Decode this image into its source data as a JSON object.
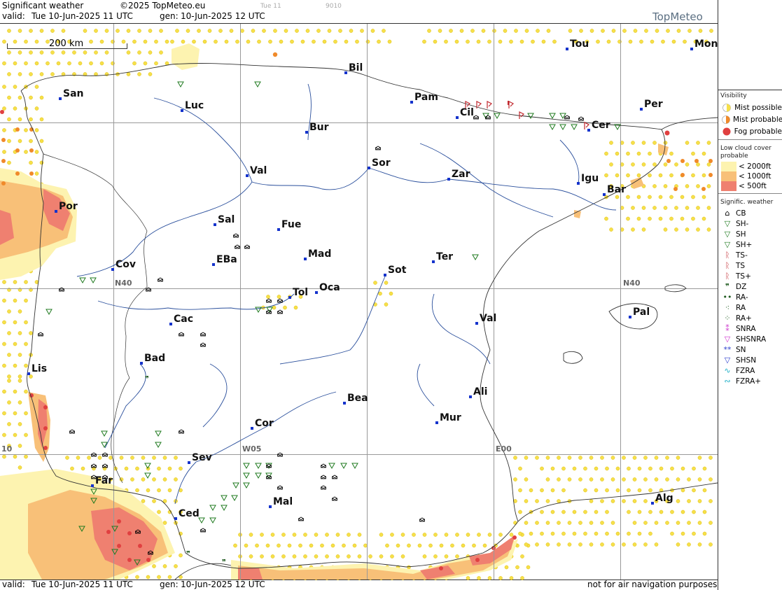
{
  "header": {
    "title": "Significant weather",
    "copyright": "©2025 TopMeteo.eu",
    "run_label": "Tue 11",
    "code": "9010",
    "valid_label": "valid:",
    "valid_value": "Tue  10-Jun-2025  11 UTC",
    "gen_label": "gen:",
    "gen_value": "10-Jun-2025 12 UTC",
    "brand": "TopMeteo"
  },
  "footer": {
    "valid_label": "valid:",
    "valid_value": "Tue  10-Jun-2025  11 UTC",
    "gen_label": "gen:",
    "gen_value": "10-Jun-2025 12 UTC",
    "disclaimer": "not for air navigation purposes"
  },
  "scale_bar": {
    "label": "200 km"
  },
  "grid_labels": {
    "n40_west": "N40",
    "n40_east": "N40",
    "w05": "W05",
    "e00": "E00",
    "w10": "10"
  },
  "cities": [
    {
      "name": "San",
      "pos": [
        86,
        141
      ]
    },
    {
      "name": "Luc",
      "pos": [
        260,
        158
      ]
    },
    {
      "name": "Bil",
      "pos": [
        494,
        104
      ]
    },
    {
      "name": "Pam",
      "pos": [
        588,
        146
      ]
    },
    {
      "name": "Tou",
      "pos": [
        810,
        70
      ]
    },
    {
      "name": "Mon",
      "pos": [
        988,
        70
      ]
    },
    {
      "name": "Cil",
      "pos": [
        653,
        168
      ]
    },
    {
      "name": "Per",
      "pos": [
        916,
        156
      ]
    },
    {
      "name": "Bur",
      "pos": [
        438,
        189
      ]
    },
    {
      "name": "Cer",
      "pos": [
        841,
        186
      ]
    },
    {
      "name": "Sor",
      "pos": [
        527,
        240
      ]
    },
    {
      "name": "Val",
      "pos": [
        353,
        251
      ]
    },
    {
      "name": "Zar",
      "pos": [
        641,
        256
      ]
    },
    {
      "name": "Igu",
      "pos": [
        826,
        262
      ]
    },
    {
      "name": "Bar",
      "pos": [
        863,
        278
      ]
    },
    {
      "name": "Por",
      "pos": [
        80,
        302
      ]
    },
    {
      "name": "Sal",
      "pos": [
        307,
        321
      ]
    },
    {
      "name": "Fue",
      "pos": [
        398,
        328
      ]
    },
    {
      "name": "Mad",
      "pos": [
        436,
        370
      ]
    },
    {
      "name": "EBa",
      "pos": [
        305,
        378
      ]
    },
    {
      "name": "Cov",
      "pos": [
        161,
        385
      ]
    },
    {
      "name": "Sot",
      "pos": [
        550,
        393
      ]
    },
    {
      "name": "Ter",
      "pos": [
        619,
        374
      ]
    },
    {
      "name": "Tol",
      "pos": [
        414,
        425
      ]
    },
    {
      "name": "Oca",
      "pos": [
        452,
        418
      ]
    },
    {
      "name": "Val",
      "pos": [
        681,
        462
      ]
    },
    {
      "name": "Pal",
      "pos": [
        900,
        453
      ]
    },
    {
      "name": "Cac",
      "pos": [
        244,
        463
      ]
    },
    {
      "name": "Bad",
      "pos": [
        202,
        519
      ]
    },
    {
      "name": "Lis",
      "pos": [
        41,
        534
      ]
    },
    {
      "name": "Ali",
      "pos": [
        672,
        567
      ]
    },
    {
      "name": "Bea",
      "pos": [
        492,
        576
      ]
    },
    {
      "name": "Mur",
      "pos": [
        624,
        604
      ]
    },
    {
      "name": "Cor",
      "pos": [
        360,
        612
      ]
    },
    {
      "name": "Sev",
      "pos": [
        270,
        661
      ]
    },
    {
      "name": "Far",
      "pos": [
        132,
        694
      ]
    },
    {
      "name": "Alg",
      "pos": [
        932,
        719
      ]
    },
    {
      "name": "Mal",
      "pos": [
        386,
        724
      ]
    },
    {
      "name": "Ced",
      "pos": [
        251,
        741
      ]
    }
  ],
  "legend": {
    "visibility_title": "Visibility",
    "visibility": [
      {
        "label": "Mist possible",
        "color": "#f6e04a"
      },
      {
        "label": "Mist probable",
        "color": "#f08a2a"
      },
      {
        "label": "Fog probable",
        "color": "#e04040"
      }
    ],
    "cloud_title": "Low cloud cover probable",
    "cloud": [
      {
        "label": "< 2000ft",
        "color": "#fdf3b0"
      },
      {
        "label": "< 1000ft",
        "color": "#f8c078"
      },
      {
        "label": "<  500ft",
        "color": "#ef8070"
      }
    ],
    "sigwx_title": "Signific. weather",
    "sigwx": [
      {
        "label": "CB",
        "icon": "cb-icon",
        "glyph": "⌂",
        "color": "#000000"
      },
      {
        "label": "SH-",
        "icon": "shower-light-icon",
        "glyph": "▽",
        "color": "#1f7a1f"
      },
      {
        "label": "SH",
        "icon": "shower-icon",
        "glyph": "▽",
        "color": "#1f7a1f"
      },
      {
        "label": "SH+",
        "icon": "shower-heavy-icon",
        "glyph": "▽",
        "color": "#1f7a1f"
      },
      {
        "label": "TS-",
        "icon": "thunderstorm-light-icon",
        "glyph": "ᚱ",
        "color": "#c0272d"
      },
      {
        "label": "TS",
        "icon": "thunderstorm-icon",
        "glyph": "ᚱ",
        "color": "#c0272d"
      },
      {
        "label": "TS+",
        "icon": "thunderstorm-heavy-icon",
        "glyph": "ᚱ",
        "color": "#c0272d"
      },
      {
        "label": "DZ",
        "icon": "drizzle-icon",
        "glyph": "❞",
        "color": "#1f5a1f"
      },
      {
        "label": "RA-",
        "icon": "rain-light-icon",
        "glyph": "••",
        "color": "#1f5a1f"
      },
      {
        "label": "RA",
        "icon": "rain-icon",
        "glyph": "⁖",
        "color": "#1f5a1f"
      },
      {
        "label": "RA+",
        "icon": "rain-heavy-icon",
        "glyph": "⁘",
        "color": "#1f5a1f"
      },
      {
        "label": "SNRA",
        "icon": "snow-rain-icon",
        "glyph": "⁑",
        "color": "#cc33cc"
      },
      {
        "label": "SHSNRA",
        "icon": "snow-rain-shower-icon",
        "glyph": "▽",
        "color": "#cc33cc"
      },
      {
        "label": "SN",
        "icon": "snow-icon",
        "glyph": "**",
        "color": "#2a3ccc"
      },
      {
        "label": "SHSN",
        "icon": "snow-shower-icon",
        "glyph": "▽",
        "color": "#2a3ccc"
      },
      {
        "label": "FZRA",
        "icon": "freezing-rain-icon",
        "glyph": "∿",
        "color": "#22b0c8"
      },
      {
        "label": "FZRA+",
        "icon": "freezing-rain-heavy-icon",
        "glyph": "∾",
        "color": "#22b0c8"
      }
    ]
  },
  "colors": {
    "coast": "#333333",
    "river": "#2a4f9c",
    "grid": "#999999",
    "city_marker": "#1533cc",
    "mist_possible": "#f6e04a",
    "mist_probable": "#f08a2a",
    "fog": "#e04040",
    "cloud_low": "#fdf3b0",
    "cloud_mid": "#f8c078",
    "cloud_high": "#ef8070",
    "shower": "#1f7a1f",
    "thunder": "#c0272d"
  }
}
